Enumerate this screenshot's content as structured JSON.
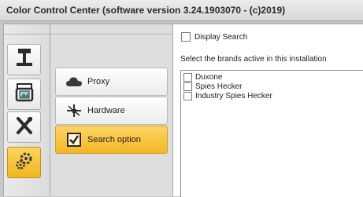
{
  "window": {
    "title": "Color Control Center (software version 3.24.1903070 - (c)2019)"
  },
  "sidebar": {
    "icons": [
      {
        "name": "monitor-station-icon",
        "active": false
      },
      {
        "name": "printer-image-icon",
        "active": false
      },
      {
        "name": "tools-icon",
        "active": false
      },
      {
        "name": "gears-icon",
        "active": true
      }
    ]
  },
  "submenu": {
    "items": [
      {
        "label": "Proxy",
        "icon": "cloud-icon",
        "active": false
      },
      {
        "label": "Hardware",
        "icon": "network-icon",
        "active": false
      },
      {
        "label": "Search option",
        "icon": "checkbox-checked-icon",
        "active": true
      }
    ]
  },
  "panel": {
    "display_search_label": "Display Search",
    "display_search_checked": false,
    "brands_title": "Select the brands active in this installation",
    "brands": [
      {
        "label": "Duxone",
        "checked": false
      },
      {
        "label": "Spies Hecker",
        "checked": false
      },
      {
        "label": "Industry Spies Hecker",
        "checked": false
      }
    ]
  },
  "colors": {
    "accent_active": "#f5b624",
    "panel_bg": "#ffffff",
    "chrome_bg": "#dedede"
  }
}
